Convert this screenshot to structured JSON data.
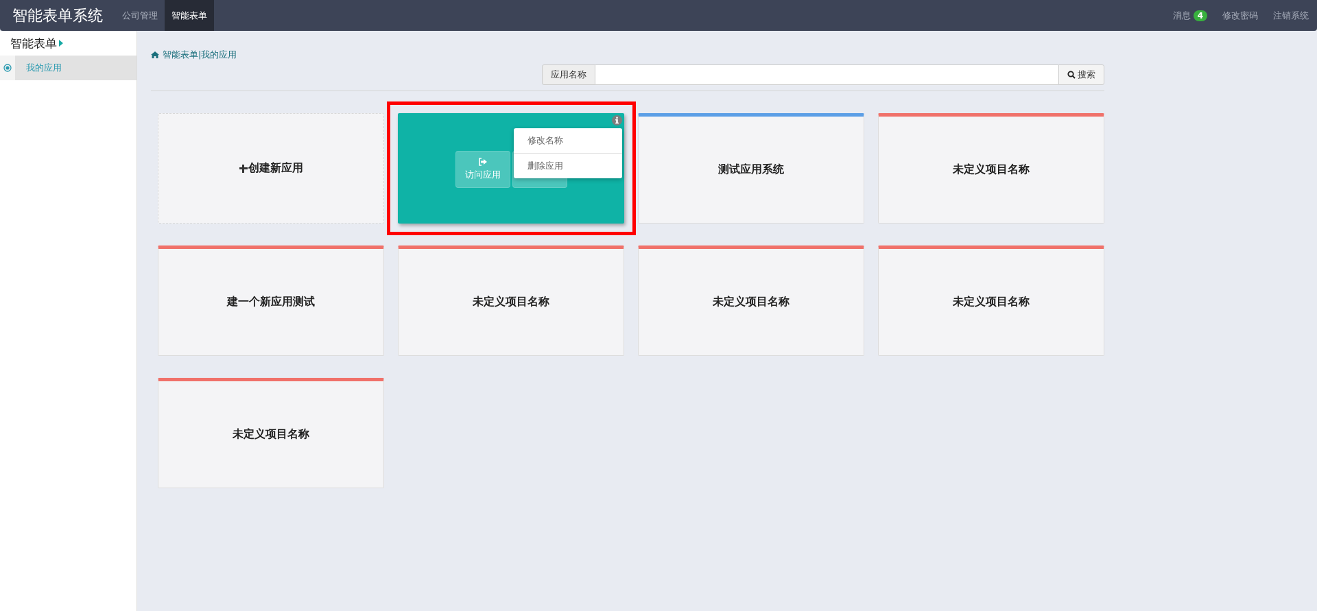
{
  "topbar": {
    "title": "智能表单系统",
    "nav": [
      {
        "label": "公司管理",
        "selected": false
      },
      {
        "label": "智能表单",
        "selected": true
      }
    ],
    "links": [
      {
        "label": "消息",
        "badge": "4"
      },
      {
        "label": "修改密码"
      },
      {
        "label": "注销系统"
      }
    ]
  },
  "sidebar": {
    "header": "智能表单",
    "items": [
      {
        "label": "我的应用",
        "selected": true
      }
    ]
  },
  "breadcrumb": "智能表单|我的应用",
  "search": {
    "label": "应用名称",
    "button": "搜索"
  },
  "cards": [
    {
      "kind": "create",
      "title": "创建新应用"
    },
    {
      "kind": "hovered",
      "highlighted": true,
      "visit": "访问应用",
      "menu": [
        "修改名称",
        "删除应用"
      ]
    },
    {
      "kind": "app",
      "title": "测试应用系统",
      "color": "#5b9ee6"
    },
    {
      "kind": "app",
      "title": "未定义项目名称",
      "color": "#f0716a"
    },
    {
      "kind": "app",
      "title": "建一个新应用测试",
      "color": "#f0716a"
    },
    {
      "kind": "app",
      "title": "未定义项目名称",
      "color": "#f0716a"
    },
    {
      "kind": "app",
      "title": "未定义项目名称",
      "color": "#f0716a"
    },
    {
      "kind": "app",
      "title": "未定义项目名称",
      "color": "#f0716a"
    },
    {
      "kind": "app",
      "title": "未定义项目名称",
      "color": "#f0716a"
    }
  ]
}
